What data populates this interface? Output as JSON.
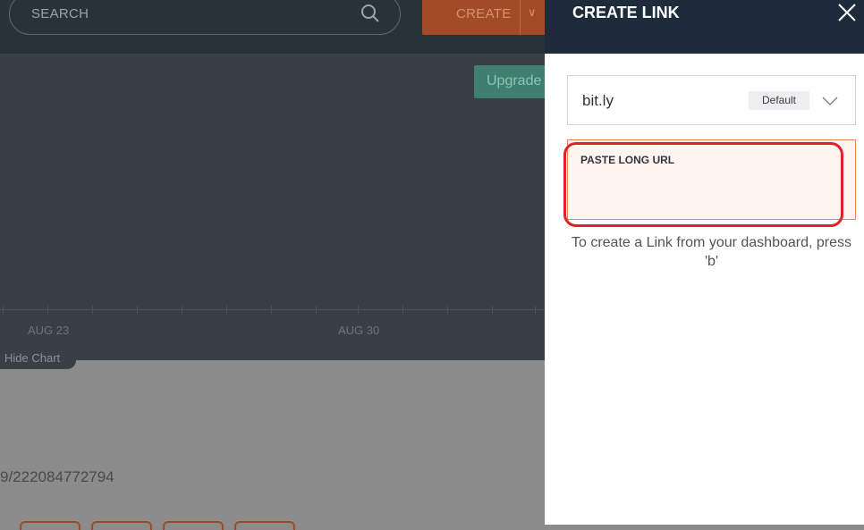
{
  "background": {
    "search": {
      "label": "SEARCH",
      "icon": "search-icon"
    },
    "create": {
      "label": "CREATE",
      "caret": "chevron-down-icon"
    },
    "upgrade": {
      "label": "Upgrade"
    },
    "chart": {
      "axis_labels": [
        "AUG 23",
        "AUG 30"
      ]
    },
    "hide_chart": {
      "label": "Hide Chart"
    },
    "link_id": "9/222084772794"
  },
  "panel": {
    "title": "CREATE LINK",
    "close_icon": "close-icon",
    "domain": {
      "value": "bit.ly",
      "badge": "Default",
      "icon": "chevron-down-icon"
    },
    "url_field": {
      "label": "PASTE LONG URL",
      "value": ""
    },
    "hint": "To create a Link from your dashboard, press 'b'"
  },
  "colors": {
    "panel_header": "#1e2b3b",
    "accent_orange": "#e9845c",
    "highlight_red": "#e02227",
    "upgrade_green": "#3f7f6f"
  }
}
